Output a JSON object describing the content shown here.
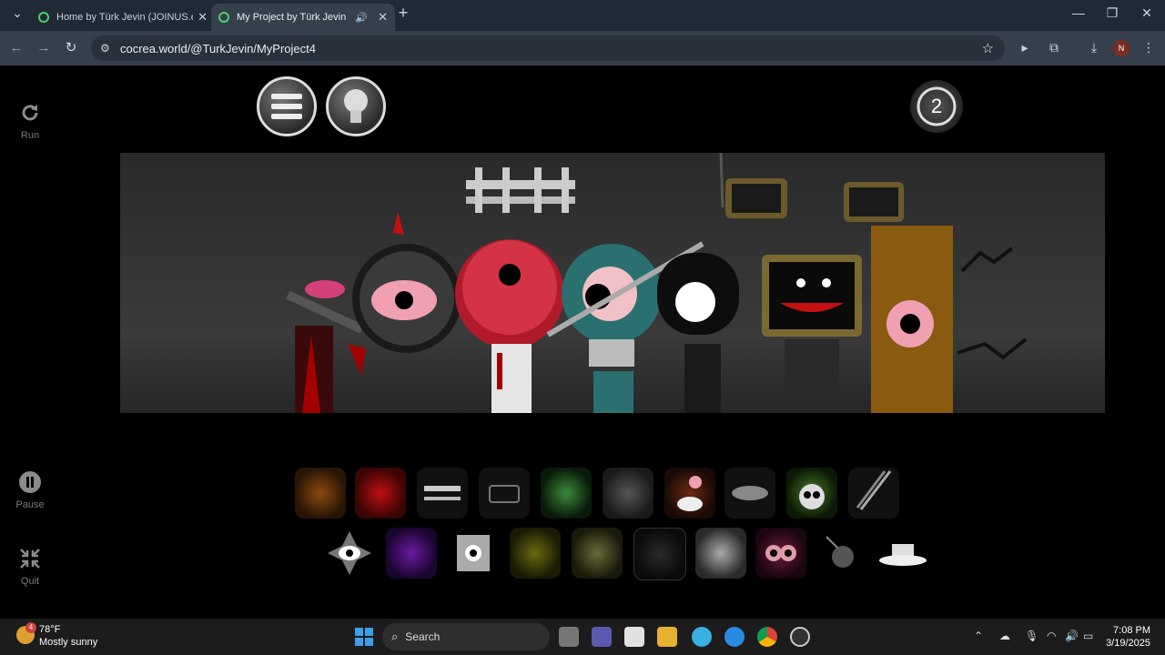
{
  "browser": {
    "tabs": [
      {
        "title": "Home by Türk Jevin (JOINUS.ex",
        "active": false
      },
      {
        "title": "My Project by Türk Jevin (JC",
        "active": true
      }
    ],
    "new_tab_icon": "plus-icon",
    "url": "cocrea.world/@TurkJevin/MyProject4",
    "profile_initial": "N"
  },
  "game": {
    "side_controls": [
      {
        "label": "Run",
        "icon": "refresh-icon"
      },
      {
        "label": "Pause",
        "icon": "pause-icon"
      },
      {
        "label": "Quit",
        "icon": "collapse-icon"
      }
    ],
    "timer_value": "2",
    "palette_row1_count": 10,
    "palette_row2_count": 10
  },
  "taskbar": {
    "weather_badge": "4",
    "weather_temp": "78°F",
    "weather_desc": "Mostly sunny",
    "search_label": "Search",
    "time": "7:08 PM",
    "date": "3/19/2025"
  },
  "colors": {
    "tab_bar": "#1f2a36",
    "toolbar": "#35404c",
    "favicon": "#4ccf6b",
    "taskbar": "#1c1c1c"
  }
}
